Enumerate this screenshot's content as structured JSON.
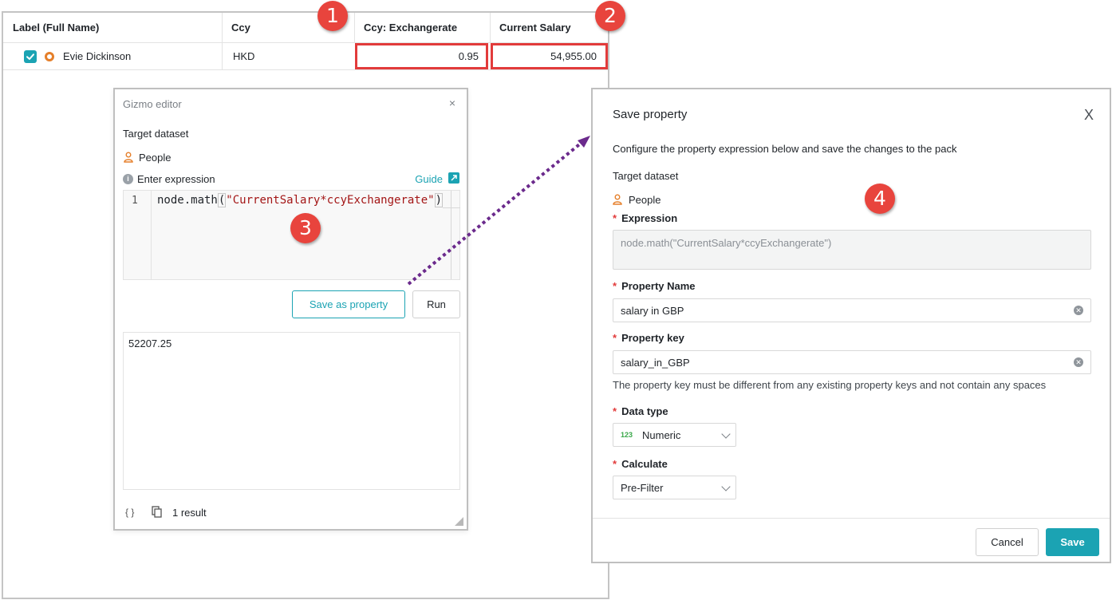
{
  "table": {
    "columns": [
      "Label (Full Name)",
      "Ccy",
      "Ccy: Exchangerate",
      "Current Salary"
    ],
    "row": {
      "name": "Evie Dickinson",
      "ccy": "HKD",
      "exchangerate": "0.95",
      "salary": "54,955.00"
    }
  },
  "badges": [
    "1",
    "2",
    "3",
    "4"
  ],
  "gizmo": {
    "title": "Gizmo editor",
    "close": "×",
    "target_dataset_label": "Target dataset",
    "dataset": "People",
    "enter_expression_label": "Enter expression",
    "guide_label": "Guide",
    "line_number": "1",
    "code_prefix": "node.math",
    "code_open": "(",
    "code_string": "\"CurrentSalary*ccyExchangerate\"",
    "code_close": ")",
    "save_as_property_label": "Save as property",
    "run_label": "Run",
    "result_value": "52207.25",
    "braces_icon": "{ }",
    "result_count": "1 result"
  },
  "save_dialog": {
    "title": "Save property",
    "close": "X",
    "description": "Configure the property expression below and save the changes to the pack",
    "target_dataset_label": "Target dataset",
    "dataset": "People",
    "required_mark": "*",
    "expression_label": "Expression",
    "expression_value": "node.math(\"CurrentSalary*ccyExchangerate\")",
    "property_name_label": "Property Name",
    "property_name_value": "salary in GBP",
    "property_key_label": "Property key",
    "property_key_value": "salary_in_GBP",
    "property_key_hint": "The property key must be different from any existing property keys and not contain any spaces",
    "data_type_label": "Data type",
    "data_type_badge": "123",
    "data_type_value": "Numeric",
    "calculate_label": "Calculate",
    "calculate_value": "Pre-Filter",
    "cancel_label": "Cancel",
    "save_label": "Save"
  },
  "colors": {
    "accent": "#1ba3b3",
    "highlight": "#e23b3b",
    "badge": "#e8443d",
    "arrow": "#6b2a8c",
    "person_icon": "#e57f2a"
  }
}
